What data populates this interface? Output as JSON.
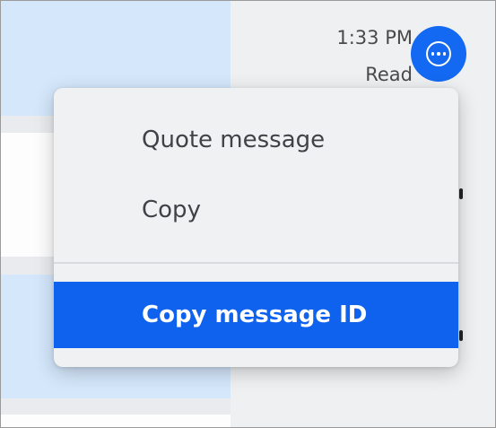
{
  "message_meta": {
    "time": "1:33 PM",
    "status": "Read"
  },
  "more_button": {
    "icon": "more-options-icon",
    "color": "#1469f2"
  },
  "context_menu": {
    "items": [
      {
        "label": "Quote message"
      },
      {
        "label": "Copy"
      },
      {
        "label": "Copy message ID",
        "highlighted": true
      }
    ],
    "highlight_color": "#0e62ee"
  }
}
